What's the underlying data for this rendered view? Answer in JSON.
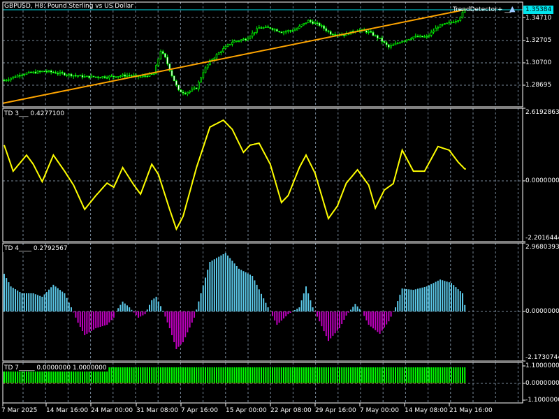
{
  "window": {
    "title": "GBPUSD, H8:  Pound Sterling vs US Dollar"
  },
  "colors": {
    "bull": "#00ff00",
    "trend_line": "#ffa500",
    "price_line": "#00e5ee",
    "td3_line": "#ffff00",
    "td4_pos": "#5bc8e8",
    "td4_neg": "#c000c0",
    "td7_bar": "#00ff00",
    "grid": "#778899"
  },
  "main": {
    "symbol_label": "GBPUSD, H8:  Pound Sterling vs US Dollar",
    "indicator_label": "TrendDetector+ __",
    "indicator_icon": "graduation-cap-icon",
    "current_price": "1.35384",
    "price_axis": [
      "1.34710",
      "1.32705",
      "1.30700",
      "1.28695"
    ]
  },
  "td3": {
    "label": "TD 3___",
    "value": "0.4277100",
    "axis": [
      "2.6192863",
      "0.0000000",
      "-2.2016444"
    ]
  },
  "td4": {
    "label": "TD 4____",
    "value": "0.2792567",
    "axis": [
      "2.9680393",
      "0.0000000",
      "-2.1730744"
    ]
  },
  "td7": {
    "label": "TD 7_____",
    "value1": "0.0000000",
    "value2": "1.0000000",
    "axis": [
      "1.1000000",
      "0.0000000",
      "-1.1000000"
    ]
  },
  "time_axis": [
    "7 Mar 2025",
    "14 Mar 16:00",
    "24 Mar 00:00",
    "31 Mar 08:00",
    "7 Apr 16:00",
    "15 Apr 00:00",
    "22 Apr 08:00",
    "29 Apr 16:00",
    "7 May 00:00",
    "14 May 08:00",
    "21 May 16:00"
  ],
  "chart_data": {
    "type": "candlestick",
    "bars": 207,
    "price_anchors": [
      [
        0,
        1.2913
      ],
      [
        8,
        1.2969
      ],
      [
        18,
        1.2994
      ],
      [
        27,
        1.2969
      ],
      [
        36,
        1.2944
      ],
      [
        46,
        1.2944
      ],
      [
        55,
        1.2957
      ],
      [
        61,
        1.2944
      ],
      [
        67,
        1.2969
      ],
      [
        70,
        1.3174
      ],
      [
        72,
        1.3112
      ],
      [
        75,
        1.2957
      ],
      [
        78,
        1.282
      ],
      [
        81,
        1.2801
      ],
      [
        86,
        1.2845
      ],
      [
        89,
        1.2988
      ],
      [
        92,
        1.3081
      ],
      [
        97,
        1.3174
      ],
      [
        102,
        1.3255
      ],
      [
        108,
        1.328
      ],
      [
        114,
        1.3379
      ],
      [
        119,
        1.3379
      ],
      [
        124,
        1.3342
      ],
      [
        130,
        1.3361
      ],
      [
        136,
        1.3441
      ],
      [
        141,
        1.3404
      ],
      [
        146,
        1.3329
      ],
      [
        152,
        1.3317
      ],
      [
        158,
        1.3361
      ],
      [
        163,
        1.3342
      ],
      [
        168,
        1.328
      ],
      [
        172,
        1.3206
      ],
      [
        177,
        1.3255
      ],
      [
        183,
        1.3298
      ],
      [
        189,
        1.3298
      ],
      [
        194,
        1.3391
      ],
      [
        199,
        1.3422
      ],
      [
        203,
        1.3453
      ],
      [
        206,
        1.3538
      ]
    ],
    "trend_line": {
      "start": [
        0,
        1.2709
      ],
      "end": [
        206,
        1.354
      ]
    },
    "td3_anchors": [
      [
        0,
        1.29
      ],
      [
        4,
        0.35
      ],
      [
        10,
        0.93
      ],
      [
        13,
        0.6
      ],
      [
        17,
        -0.03
      ],
      [
        22,
        0.93
      ],
      [
        27,
        0.35
      ],
      [
        31,
        -0.15
      ],
      [
        36,
        -1.03
      ],
      [
        41,
        -0.53
      ],
      [
        46,
        -0.08
      ],
      [
        49,
        -0.23
      ],
      [
        53,
        0.48
      ],
      [
        58,
        -0.15
      ],
      [
        61,
        -0.48
      ],
      [
        66,
        0.6
      ],
      [
        69,
        0.23
      ],
      [
        74,
        -1.03
      ],
      [
        77,
        -1.74
      ],
      [
        80,
        -1.28
      ],
      [
        86,
        0.48
      ],
      [
        92,
        1.94
      ],
      [
        98,
        2.19
      ],
      [
        102,
        1.86
      ],
      [
        107,
        1.03
      ],
      [
        110,
        1.29
      ],
      [
        114,
        1.36
      ],
      [
        119,
        0.6
      ],
      [
        124,
        -0.78
      ],
      [
        127,
        -0.53
      ],
      [
        132,
        0.48
      ],
      [
        135,
        0.93
      ],
      [
        139,
        0.28
      ],
      [
        145,
        -1.36
      ],
      [
        149,
        -0.91
      ],
      [
        153,
        -0.08
      ],
      [
        158,
        0.4
      ],
      [
        163,
        -0.15
      ],
      [
        166,
        -0.98
      ],
      [
        170,
        -0.33
      ],
      [
        174,
        -0.1
      ],
      [
        178,
        1.11
      ],
      [
        183,
        0.35
      ],
      [
        188,
        0.35
      ],
      [
        194,
        1.24
      ],
      [
        199,
        1.11
      ],
      [
        203,
        0.68
      ],
      [
        206,
        0.43
      ]
    ],
    "td4_anchors": [
      [
        0,
        1.64
      ],
      [
        3,
        1.09
      ],
      [
        8,
        0.79
      ],
      [
        13,
        0.79
      ],
      [
        17,
        0.64
      ],
      [
        22,
        1.16
      ],
      [
        27,
        0.79
      ],
      [
        30,
        0.18
      ],
      [
        33,
        -0.49
      ],
      [
        36,
        -1.03
      ],
      [
        41,
        -0.73
      ],
      [
        46,
        -0.58
      ],
      [
        49,
        -0.27
      ],
      [
        50,
        0
      ],
      [
        53,
        0.43
      ],
      [
        56,
        0.18
      ],
      [
        60,
        -0.27
      ],
      [
        63,
        -0.12
      ],
      [
        66,
        0.49
      ],
      [
        68,
        0.64
      ],
      [
        71,
        0.03
      ],
      [
        74,
        -0.73
      ],
      [
        77,
        -1.64
      ],
      [
        80,
        -1.34
      ],
      [
        85,
        -0.27
      ],
      [
        88,
        0.79
      ],
      [
        92,
        2.16
      ],
      [
        99,
        2.55
      ],
      [
        105,
        1.86
      ],
      [
        111,
        1.55
      ],
      [
        118,
        0.18
      ],
      [
        122,
        -0.58
      ],
      [
        127,
        -0.12
      ],
      [
        132,
        0.18
      ],
      [
        135,
        1.09
      ],
      [
        138,
        0.18
      ],
      [
        141,
        -0.43
      ],
      [
        145,
        -1.28
      ],
      [
        150,
        -0.73
      ],
      [
        153,
        -0.18
      ],
      [
        157,
        0.33
      ],
      [
        160,
        0
      ],
      [
        163,
        -0.58
      ],
      [
        168,
        -0.97
      ],
      [
        172,
        -0.43
      ],
      [
        175,
        0.18
      ],
      [
        178,
        1.0
      ],
      [
        183,
        0.94
      ],
      [
        189,
        1.09
      ],
      [
        195,
        1.39
      ],
      [
        200,
        1.24
      ],
      [
        205,
        0.79
      ],
      [
        206,
        0.28
      ]
    ],
    "td7_value": 1.0
  }
}
